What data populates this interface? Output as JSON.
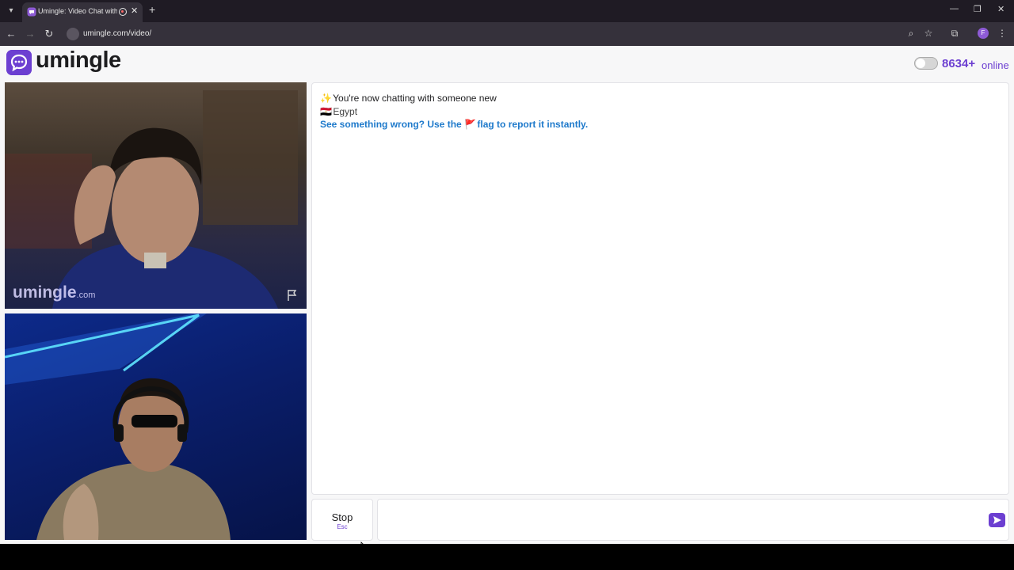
{
  "browser": {
    "tab_title": "Umingle: Video Chat with S",
    "new_tab_symbol": "+",
    "url": "umingle.com/video/",
    "profile_initial": "F"
  },
  "site": {
    "logo_text": "umingle",
    "online_count": "8634+",
    "online_label": "online"
  },
  "video": {
    "watermark_main": "umingle",
    "watermark_domain": ".com"
  },
  "chat": {
    "messages": [
      {
        "icon": "✨",
        "text": "You're now chatting with someone new"
      },
      {
        "icon": "🇪🇬",
        "text": "Egypt"
      },
      {
        "text_before": "See something wrong? Use the",
        "icon": "🚩",
        "text_after": "flag to report it instantly."
      }
    ],
    "input_placeholder": ""
  },
  "controls": {
    "stop_label": "Stop",
    "stop_hint": "Esc"
  },
  "colors": {
    "brand": "#6c3fd1",
    "link": "#1f7acb"
  }
}
